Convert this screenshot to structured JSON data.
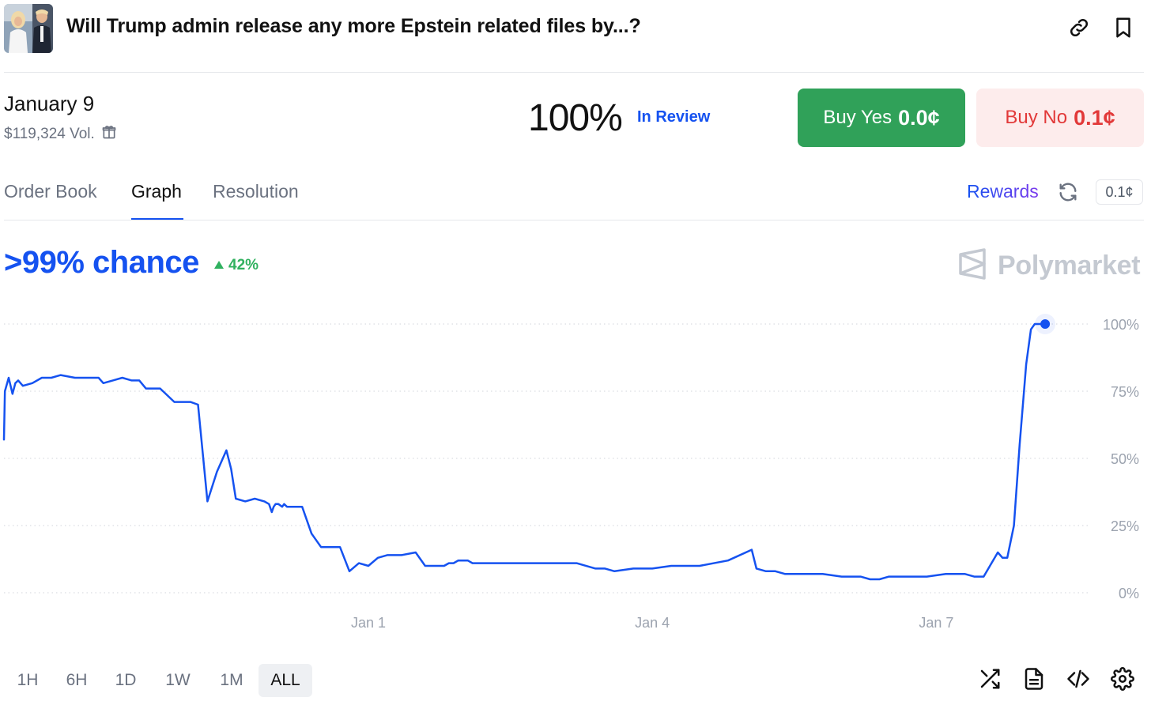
{
  "header": {
    "title": "Will Trump admin release any more Epstein related files by...?",
    "thumbnail_icon": "market-thumbnail",
    "link_icon": "link-icon",
    "bookmark_icon": "bookmark-icon"
  },
  "market": {
    "date": "January 9",
    "volume": "$119,324 Vol.",
    "percent": "100%",
    "status": "In Review",
    "buy_yes_label": "Buy Yes",
    "buy_yes_price": "0.0¢",
    "buy_no_label": "Buy No",
    "buy_no_price": "0.1¢"
  },
  "tabs": [
    {
      "label": "Order Book",
      "active": false
    },
    {
      "label": "Graph",
      "active": true
    },
    {
      "label": "Resolution",
      "active": false
    }
  ],
  "rewards": {
    "label": "Rewards",
    "chip": "0.1¢"
  },
  "summary": {
    "chance": ">99% chance",
    "delta": "42%",
    "brand": "Polymarket"
  },
  "colors": {
    "accent": "#1552f0",
    "yes": "#30a159",
    "no_bg": "#fdecec",
    "no_text": "#e23939",
    "delta": "#30b15f",
    "grid": "#d1d5db",
    "axis_text": "#9ca3af"
  },
  "chart_data": {
    "type": "line",
    "y_ticks": [
      "0%",
      "25%",
      "50%",
      "75%",
      "100%"
    ],
    "ylim": [
      0,
      100
    ],
    "x_ticks": [
      {
        "label": "Jan 1",
        "day": 1
      },
      {
        "label": "Jan 4",
        "day": 4
      },
      {
        "label": "Jan 7",
        "day": 7
      }
    ],
    "xlim": [
      -2.85,
      8.45
    ],
    "grid": true,
    "series": [
      {
        "x": [
          -2.85,
          -2.84,
          -2.8,
          -2.76,
          -2.73,
          -2.7,
          -2.65,
          -2.55,
          -2.45,
          -2.35,
          -2.25,
          -2.1,
          -1.95,
          -1.85,
          -1.8,
          -1.7,
          -1.6,
          -1.5,
          -1.42,
          -1.35,
          -1.2,
          -1.05,
          -0.95,
          -0.88,
          -0.8,
          -0.7,
          -0.6,
          -0.5,
          -0.45,
          -0.4,
          -0.3,
          -0.2,
          -0.1,
          -0.05,
          -0.02,
          0.0,
          0.02,
          0.05,
          0.09,
          0.11,
          0.14,
          0.17,
          0.2,
          0.25,
          0.3,
          0.4,
          0.5,
          0.6,
          0.7,
          0.8,
          0.9,
          1.0,
          1.1,
          1.2,
          1.35,
          1.5,
          1.6,
          1.7,
          1.75,
          1.8,
          1.85,
          1.9,
          1.95,
          2.05,
          2.1,
          2.2,
          2.3,
          2.4,
          2.6,
          2.8,
          3.0,
          3.2,
          3.4,
          3.5,
          3.6,
          3.8,
          4.0,
          4.2,
          4.5,
          4.8,
          5.05,
          5.1,
          5.2,
          5.3,
          5.4,
          5.6,
          5.8,
          6.0,
          6.2,
          6.3,
          6.35,
          6.4,
          6.5,
          6.7,
          6.9,
          7.1,
          7.3,
          7.4,
          7.5,
          7.65,
          7.7,
          7.75,
          7.82,
          7.88,
          7.95,
          8.0,
          8.04,
          8.09,
          8.15
        ],
        "y": [
          57,
          75,
          80,
          74,
          78,
          79,
          77,
          78,
          80,
          80,
          81,
          80,
          80,
          80,
          78,
          79,
          80,
          79,
          79,
          76,
          76,
          71,
          71,
          71,
          70,
          34,
          45,
          53,
          46,
          35,
          34,
          35,
          34,
          33,
          30,
          32,
          33,
          33,
          32,
          33,
          32,
          32,
          32,
          32,
          32,
          22,
          17,
          17,
          17,
          8,
          11,
          10,
          13,
          14,
          14,
          15,
          10,
          10,
          10,
          10,
          11,
          11,
          12,
          12,
          11,
          11,
          11,
          11,
          11,
          11,
          11,
          11,
          9,
          9,
          8,
          9,
          9,
          10,
          10,
          12,
          16,
          9,
          8,
          8,
          7,
          7,
          7,
          6,
          6,
          5,
          5,
          5,
          6,
          6,
          6,
          7,
          7,
          6,
          6,
          15,
          13,
          13,
          25,
          55,
          85,
          98,
          100,
          100,
          100
        ]
      }
    ]
  },
  "ranges": [
    {
      "label": "1H",
      "active": false
    },
    {
      "label": "6H",
      "active": false
    },
    {
      "label": "1D",
      "active": false
    },
    {
      "label": "1W",
      "active": false
    },
    {
      "label": "1M",
      "active": false
    },
    {
      "label": "ALL",
      "active": true
    }
  ],
  "tools": [
    "shuffle-icon",
    "document-icon",
    "code-icon",
    "settings-icon"
  ]
}
